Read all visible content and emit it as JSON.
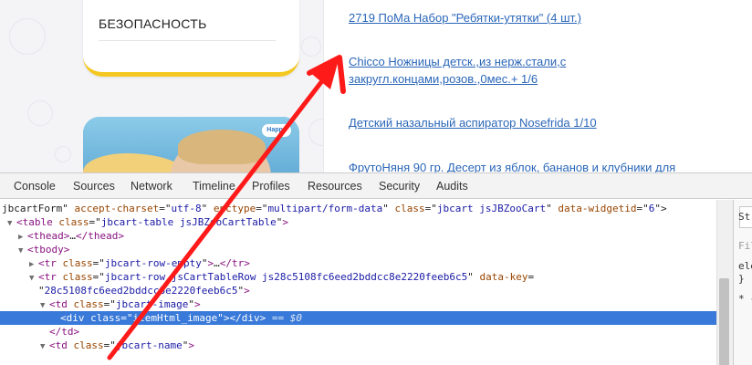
{
  "sidebar_menu": {
    "item_label": "БЕЗОПАСНОСТЬ"
  },
  "banner": {
    "logo_text": "Happy"
  },
  "products": [
    {
      "label": "2719 ПоМа Набор \"Ребятки-утятки\" (4 шт.)"
    },
    {
      "line1": "Chicco Ножницы детск.,из нерж.стали,с",
      "line2": "закругл.концами,розов.,0мес.+ 1/6"
    },
    {
      "label": "Детский назальный аспиратор Nosefrida 1/10"
    },
    {
      "label": "ФрутоНяня 90 гр. Десерт из яблок, бананов и клубники для"
    }
  ],
  "devtools": {
    "tabs": [
      "Console",
      "Sources",
      "Network",
      "Timeline",
      "Profiles",
      "Resources",
      "Security",
      "Audits"
    ],
    "lines": [
      {
        "indent": 0,
        "tri": "",
        "parts": [
          [
            "txt",
            "jbcartForm\" "
          ],
          [
            "attr",
            "accept-charset"
          ],
          [
            "txt",
            "=\""
          ],
          [
            "val",
            "utf-8"
          ],
          [
            "txt",
            "\" "
          ],
          [
            "attr",
            "enctype"
          ],
          [
            "txt",
            "=\""
          ],
          [
            "val",
            "multipart/form-data"
          ],
          [
            "txt",
            "\" "
          ],
          [
            "attr",
            "class"
          ],
          [
            "txt",
            "=\""
          ],
          [
            "val",
            "jbcart jsJBZooCart"
          ],
          [
            "txt",
            "\" "
          ],
          [
            "attr",
            "data-widgetid"
          ],
          [
            "txt",
            "=\""
          ],
          [
            "val",
            "6"
          ],
          [
            "txt",
            "\">"
          ]
        ]
      },
      {
        "indent": 1,
        "tri": "▼",
        "parts": [
          [
            "tag",
            "<table "
          ],
          [
            "attr",
            "class"
          ],
          [
            "txt",
            "=\""
          ],
          [
            "val",
            "jbcart-table jsJBZooCartTable"
          ],
          [
            "txt",
            "\""
          ],
          [
            "tag",
            ">"
          ]
        ]
      },
      {
        "indent": 2,
        "tri": "▶",
        "parts": [
          [
            "tag",
            "<thead>"
          ],
          [
            "txt",
            "…"
          ],
          [
            "tag",
            "</thead>"
          ]
        ]
      },
      {
        "indent": 2,
        "tri": "▼",
        "parts": [
          [
            "tag",
            "<tbody>"
          ]
        ]
      },
      {
        "indent": 3,
        "tri": "▶",
        "parts": [
          [
            "tag",
            "<tr "
          ],
          [
            "attr",
            "class"
          ],
          [
            "txt",
            "=\""
          ],
          [
            "val",
            "jbcart-row-empty"
          ],
          [
            "txt",
            "\""
          ],
          [
            "tag",
            ">"
          ],
          [
            "txt",
            "…"
          ],
          [
            "tag",
            "</tr>"
          ]
        ]
      },
      {
        "indent": 3,
        "tri": "▼",
        "parts": [
          [
            "tag",
            "<tr "
          ],
          [
            "attr",
            "class"
          ],
          [
            "txt",
            "=\""
          ],
          [
            "val",
            "jbcart-row jsCartTableRow js28c5108fc6eed2bddcc8e2220feeb6c5"
          ],
          [
            "txt",
            "\" "
          ],
          [
            "attr",
            "data-key"
          ],
          [
            "txt",
            "="
          ]
        ]
      },
      {
        "indent": 3,
        "tri": "",
        "parts": [
          [
            "txt",
            "\""
          ],
          [
            "val",
            "28c5108fc6eed2bddcc8e2220feeb6c5"
          ],
          [
            "txt",
            "\""
          ],
          [
            "tag",
            ">"
          ]
        ]
      },
      {
        "indent": 4,
        "tri": "▼",
        "parts": [
          [
            "tag",
            "<td "
          ],
          [
            "attr",
            "class"
          ],
          [
            "txt",
            "=\""
          ],
          [
            "val",
            "jbcart-image"
          ],
          [
            "txt",
            "\""
          ],
          [
            "tag",
            ">"
          ]
        ]
      },
      {
        "indent": 5,
        "tri": "",
        "selected": true,
        "parts": [
          [
            "tag",
            "<div "
          ],
          [
            "attr",
            "class"
          ],
          [
            "txt",
            "=\""
          ],
          [
            "val",
            "itemHtml_image"
          ],
          [
            "txt",
            "\""
          ],
          [
            "tag",
            ">"
          ],
          [
            "tag",
            "</div>"
          ]
        ],
        "extra": " == $0"
      },
      {
        "indent": 4,
        "tri": "",
        "parts": [
          [
            "tag",
            "</td>"
          ]
        ]
      },
      {
        "indent": 4,
        "tri": "▼",
        "parts": [
          [
            "tag",
            "<td "
          ],
          [
            "attr",
            "class"
          ],
          [
            "txt",
            "=\""
          ],
          [
            "val",
            "jbcart-name"
          ],
          [
            "txt",
            "\""
          ],
          [
            "tag",
            ">"
          ]
        ]
      }
    ],
    "side_panel": {
      "top_text": "St",
      "filter_text": "Fil",
      "rule1": "ele",
      "rule2": "}",
      "rule3": "* {"
    }
  },
  "colors": {
    "link": "#2a66b8",
    "selection": "#3879d9",
    "arrow": "#ff1a1a",
    "accent_yellow": "#f4c820"
  }
}
